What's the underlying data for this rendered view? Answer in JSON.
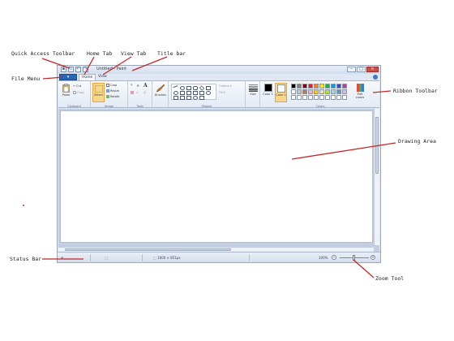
{
  "callouts": {
    "quick_access_toolbar": "Quick Access Toolbar",
    "home_tab": "Home Tab",
    "view_tab": "View Tab",
    "title_bar": "Title bar",
    "file_menu": "File Menu",
    "ribbon_toolbar": "Ribbon Toolbar",
    "drawing_area": "Drawing Area",
    "status_bar": "Status Bar",
    "zoom_tool": "Zoom Tool"
  },
  "window": {
    "title": "Untitled - Paint",
    "tabs": {
      "home": "Home",
      "view": "View"
    },
    "ribbon": {
      "groups": {
        "clipboard": "Clipboard",
        "image": "Image",
        "tools": "Tools",
        "shapes": "Shapes",
        "colors": "Colors"
      },
      "clipboard": {
        "paste": "Paste",
        "cut": "Cut",
        "copy": "Copy"
      },
      "image": {
        "select": "Select",
        "crop": "Crop",
        "resize": "Resize",
        "rotate": "Rotate"
      },
      "tools": {
        "brushes": "Brushes"
      },
      "shapes": {
        "outline": "Outline",
        "fill": "Fill"
      },
      "size": "Size",
      "colors": {
        "color1": "Color 1",
        "color2": "Color 2",
        "edit": "Edit colors"
      },
      "palette": [
        "#000000",
        "#7f7f7f",
        "#880015",
        "#ed1c24",
        "#ff7f27",
        "#fff200",
        "#22b14c",
        "#00a2e8",
        "#3f48cc",
        "#a349a4",
        "#ffffff",
        "#c3c3c3",
        "#b97a57",
        "#ffaec9",
        "#ffc90e",
        "#efe4b0",
        "#b5e61d",
        "#99d9ea",
        "#7092be",
        "#c8bfe7"
      ]
    },
    "status": {
      "dimensions": "1600 × 851px",
      "zoom_level": "100%"
    }
  },
  "colors": {
    "callout_line": "#c62828",
    "accent": "#2a66b8"
  }
}
